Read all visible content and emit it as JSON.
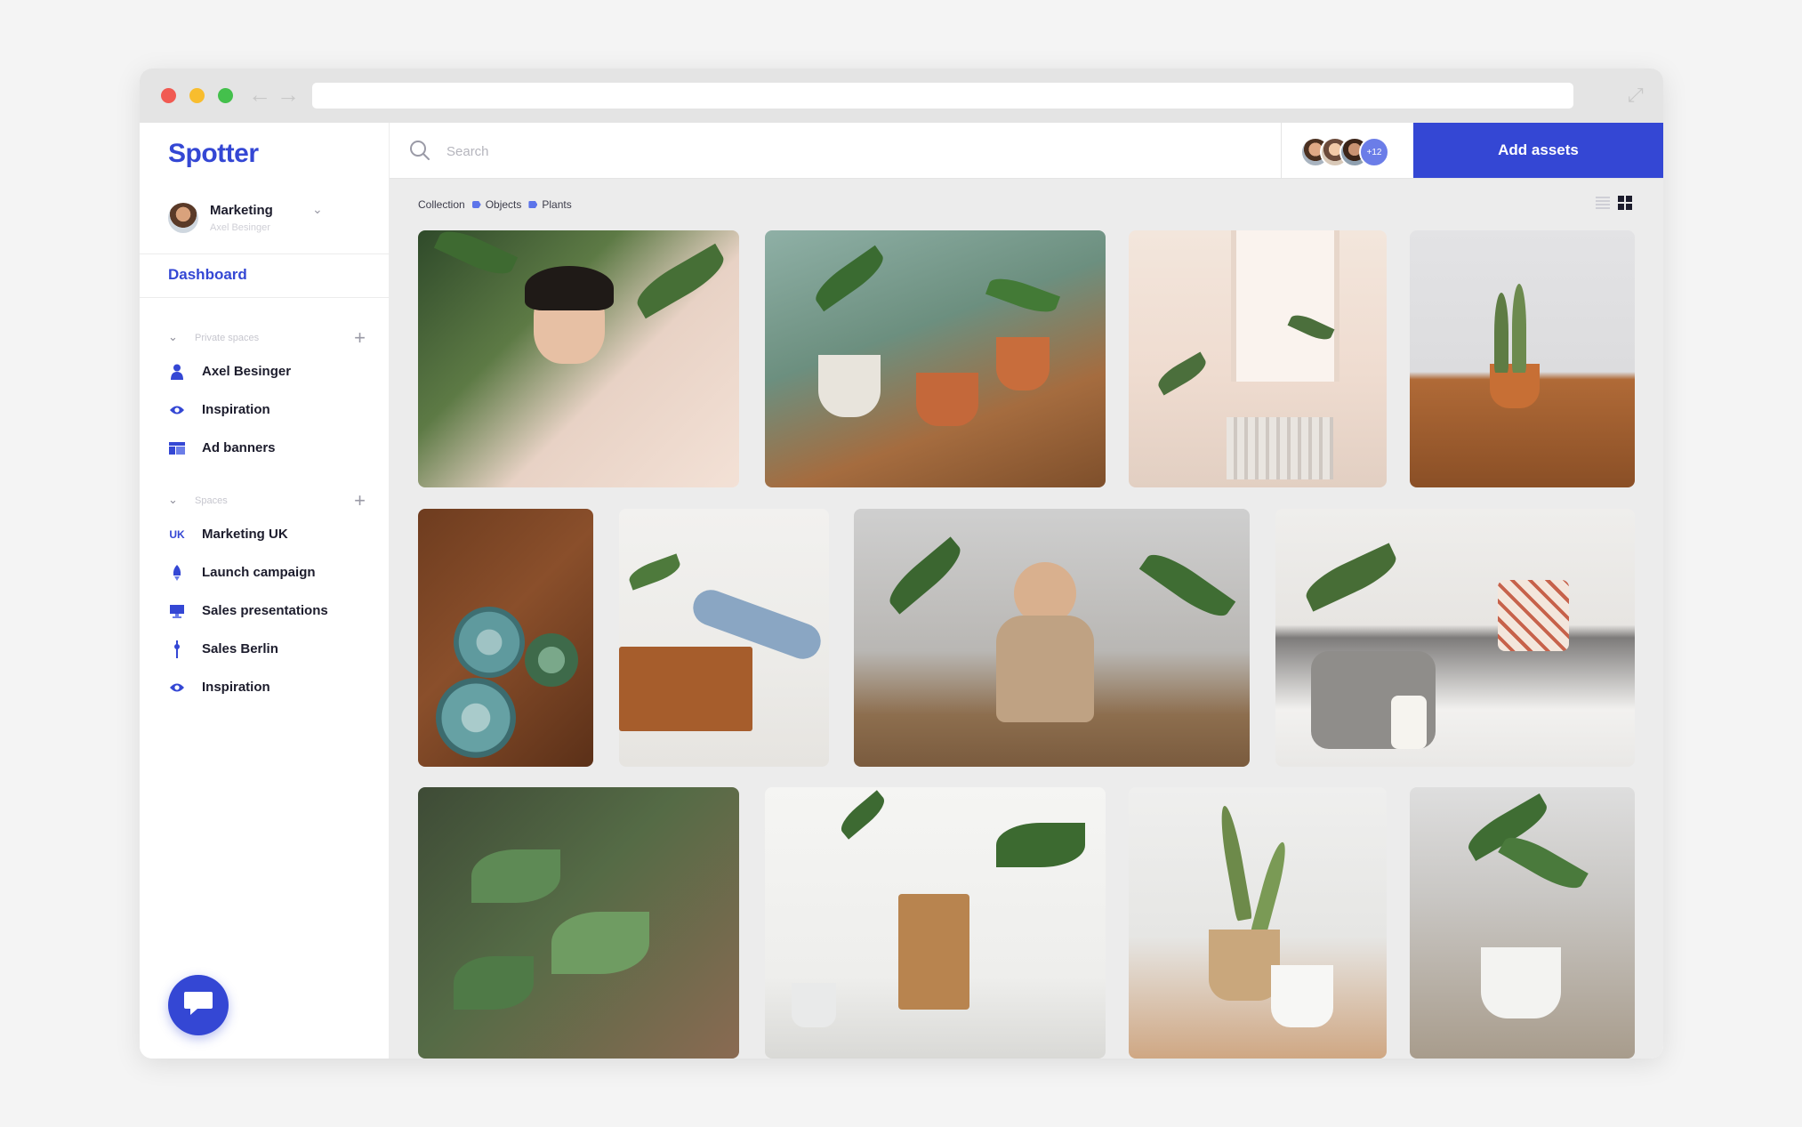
{
  "colors": {
    "brand": "#3447d4",
    "accent_tag": "#5c74ea"
  },
  "app": {
    "logo": "Spotter"
  },
  "account": {
    "name": "Marketing",
    "subtitle": "Axel Besinger"
  },
  "nav": {
    "dashboard": "Dashboard"
  },
  "private_spaces": {
    "label": "Private spaces",
    "items": [
      {
        "label": "Axel Besinger",
        "icon": "user-icon"
      },
      {
        "label": "Inspiration",
        "icon": "eye-icon"
      },
      {
        "label": "Ad banners",
        "icon": "banner-icon"
      }
    ]
  },
  "spaces": {
    "label": "Spaces",
    "items": [
      {
        "label": "Marketing UK",
        "icon": "uk-icon",
        "icon_text": "UK"
      },
      {
        "label": "Launch campaign",
        "icon": "rocket-icon"
      },
      {
        "label": "Sales presentations",
        "icon": "monitor-icon"
      },
      {
        "label": "Sales Berlin",
        "icon": "tower-icon"
      },
      {
        "label": "Inspiration",
        "icon": "eye-icon"
      }
    ]
  },
  "search": {
    "placeholder": "Search"
  },
  "collaborators": {
    "more": "+12"
  },
  "actions": {
    "add_assets": "Add assets"
  },
  "breadcrumb": [
    "Collection",
    "Objects",
    "Plants"
  ]
}
